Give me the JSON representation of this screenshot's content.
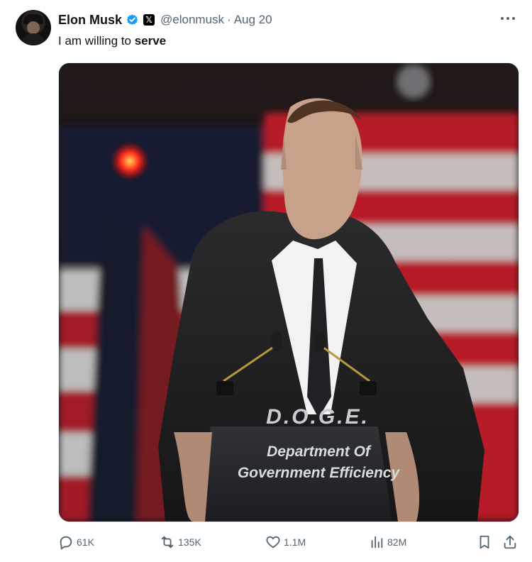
{
  "post": {
    "author_name": "Elon Musk",
    "handle": "@elonmusk",
    "separator": "·",
    "date": "Aug 20",
    "text_prefix": "I am willing to ",
    "text_bold": "serve",
    "media": {
      "podium_title": "D.O.G.E.",
      "podium_line1": "Department Of",
      "podium_line2": "Government Efficiency"
    }
  },
  "actions": {
    "replies": "61K",
    "reposts": "135K",
    "likes": "1.1M",
    "views": "82M"
  },
  "icons": {
    "verified": "verified-badge-icon",
    "x_badge": "x-logo-icon",
    "more": "more-options-icon",
    "reply": "reply-icon",
    "repost": "repost-icon",
    "like": "heart-icon",
    "views": "views-icon",
    "bookmark": "bookmark-icon",
    "share": "share-icon"
  },
  "colors": {
    "text_primary": "#0f1419",
    "text_secondary": "#536471",
    "verified_blue": "#1d9bf0"
  }
}
